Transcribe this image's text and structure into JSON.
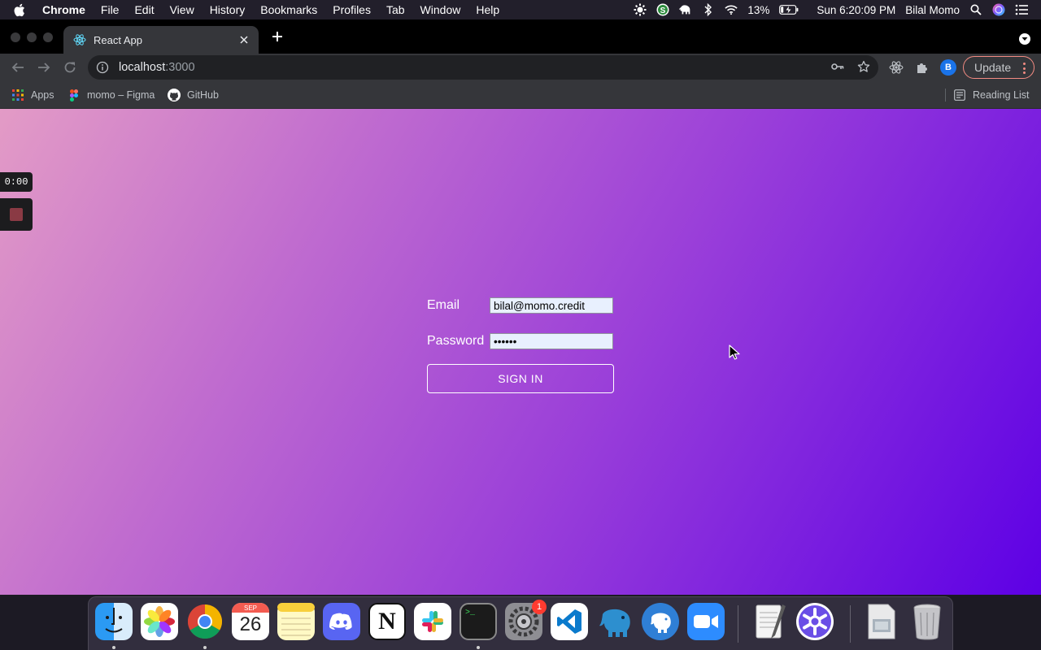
{
  "menubar": {
    "app_name": "Chrome",
    "menus": [
      "File",
      "Edit",
      "View",
      "History",
      "Bookmarks",
      "Profiles",
      "Tab",
      "Window",
      "Help"
    ],
    "battery": "13%",
    "clock": "Sun 6:20:09 PM",
    "user": "Bilal Momo"
  },
  "browser": {
    "tab_title": "React App",
    "url_host": "localhost",
    "url_port": ":3000",
    "update_label": "Update",
    "profile_initial": "B",
    "bookmarks": [
      "Apps",
      "momo – Figma",
      "GitHub"
    ],
    "reading_list": "Reading List"
  },
  "recorder": {
    "timer": "0:00"
  },
  "login": {
    "email_label": "Email",
    "email_value": "bilal@momo.credit",
    "password_label": "Password",
    "password_value": "••••••",
    "sign_in_label": "SIGN IN"
  },
  "dock": {
    "calendar_month": "SEP",
    "calendar_day": "26",
    "settings_badge": "1",
    "apps": [
      "finder",
      "photos",
      "chrome",
      "calendar",
      "notes",
      "discord",
      "notion",
      "slack",
      "terminal",
      "system-preferences",
      "vscode",
      "tableplus",
      "postgres",
      "zoom",
      "textedit",
      "snowflake",
      "preview",
      "trash"
    ]
  },
  "colors": {
    "gradient_start": "#e39bc6",
    "gradient_end": "#5d00e5",
    "update_accent": "#f28b82",
    "profile_blue": "#1a73e8"
  }
}
